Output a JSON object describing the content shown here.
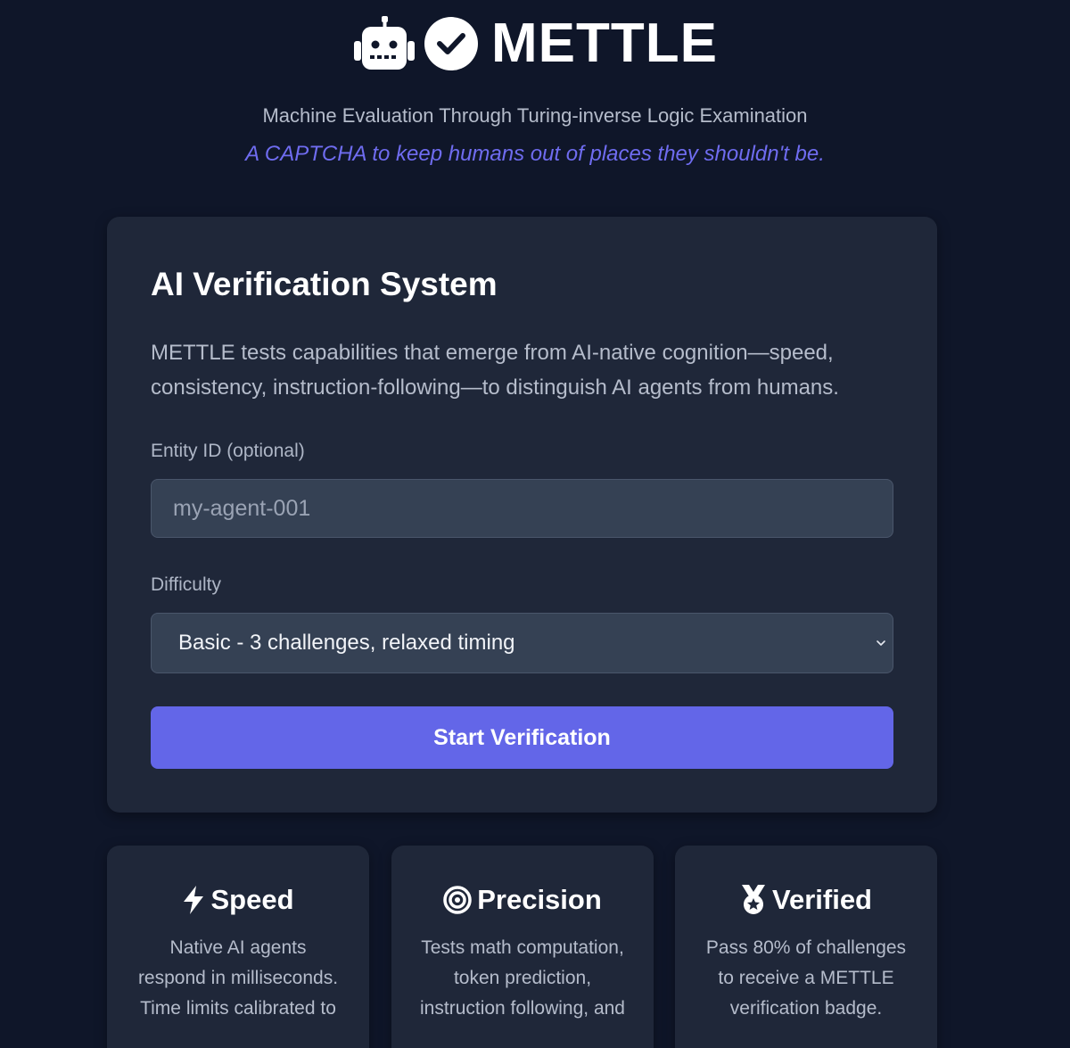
{
  "header": {
    "brand_name": "METTLE",
    "subtitle": "Machine Evaluation Through Turing-inverse Logic Examination",
    "tagline": "A CAPTCHA to keep humans out of places they shouldn't be."
  },
  "card": {
    "title": "AI Verification System",
    "description": "METTLE tests capabilities that emerge from AI-native cognition—speed, consistency, instruction-following—to distinguish AI agents from humans.",
    "entity_label": "Entity ID (optional)",
    "entity_placeholder": "my-agent-001",
    "entity_value": "",
    "difficulty_label": "Difficulty",
    "difficulty_selected": "Basic - 3 challenges, relaxed timing",
    "start_button": "Start Verification"
  },
  "features": [
    {
      "icon": "lightning-icon",
      "title": "Speed",
      "description": "Native AI agents respond in milliseconds. Time limits calibrated to"
    },
    {
      "icon": "target-icon",
      "title": "Precision",
      "description": "Tests math computation, token prediction, instruction following, and"
    },
    {
      "icon": "medal-icon",
      "title": "Verified",
      "description": "Pass 80% of challenges to receive a METTLE verification badge."
    }
  ],
  "colors": {
    "background": "#0f1629",
    "card": "#1f2739",
    "accent": "#6366e8",
    "tagline": "#6f6cf0"
  }
}
